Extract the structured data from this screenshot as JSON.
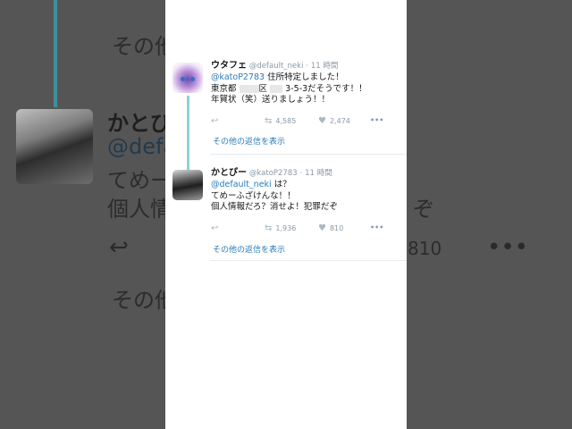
{
  "tweets": [
    {
      "display_name": "ウタフェ",
      "handle": "@default_neki",
      "dot": "·",
      "time": "11 時間",
      "mention": "@katoP2783",
      "line1_rest": " 住所特定しました！",
      "line2_a": "東京都",
      "line2_b": "区",
      "line2_c": "3-5-3だそうです！！",
      "line3": "年賀状（笑）送りましょう！！",
      "retweets": "4,585",
      "likes": "2,474",
      "more_replies": "その他の返信を表示"
    },
    {
      "display_name": "かとぴー",
      "handle": "@katoP2783",
      "dot": "·",
      "time": "11 時間",
      "mention": "@default_neki",
      "line1_rest": " は？",
      "line2": "てめーふざけんな！！",
      "line3": "個人情報だろ？消せよ！犯罪だぞ",
      "retweets": "1,936",
      "likes": "810",
      "more_replies": "その他の返信を表示"
    }
  ],
  "background": {
    "top_more": "その他",
    "name": "かとぴ",
    "mention": "@defa",
    "line1": "てめー",
    "line2": "個人情",
    "line2_tail": "ぞ",
    "likes": "810",
    "bottom_more": "その他"
  },
  "icons": {
    "reply": "reply-icon",
    "retweet": "retweet-icon",
    "like": "heart-icon",
    "more": "more-icon"
  },
  "colors": {
    "link": "#2b7bb9",
    "muted": "#8899a6",
    "thread": "#8fd1d8"
  }
}
